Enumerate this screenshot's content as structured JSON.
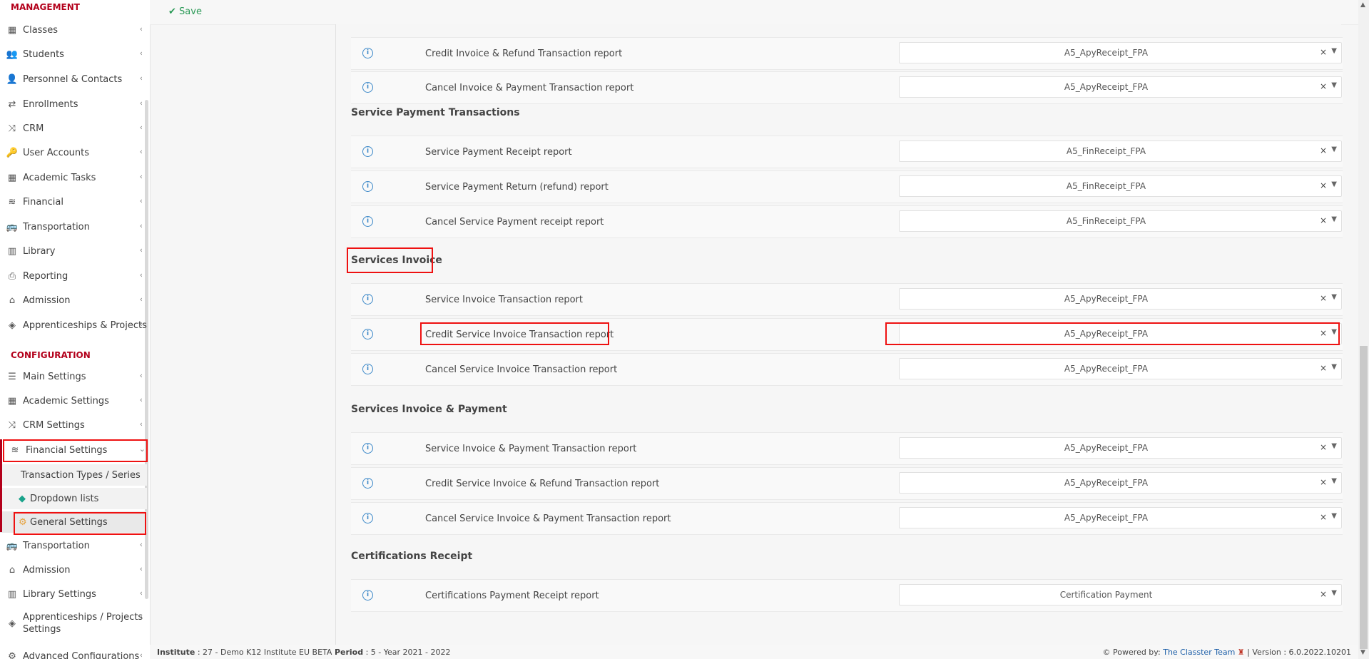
{
  "toolbar": {
    "save_label": "Save"
  },
  "sidebar": {
    "management_label": "MANAGEMENT",
    "configuration_label": "CONFIGURATION",
    "management_items": [
      {
        "label": "Classes",
        "icon": "classes-icon"
      },
      {
        "label": "Students",
        "icon": "students-icon"
      },
      {
        "label": "Personnel & Contacts",
        "icon": "personnel-icon"
      },
      {
        "label": "Enrollments",
        "icon": "enrollments-icon"
      },
      {
        "label": "CRM",
        "icon": "crm-icon"
      },
      {
        "label": "User Accounts",
        "icon": "key-icon"
      },
      {
        "label": "Academic Tasks",
        "icon": "tasks-icon"
      },
      {
        "label": "Financial",
        "icon": "coins-icon"
      },
      {
        "label": "Transportation",
        "icon": "bus-icon"
      },
      {
        "label": "Library",
        "icon": "library-icon"
      },
      {
        "label": "Reporting",
        "icon": "printer-icon"
      },
      {
        "label": "Admission",
        "icon": "institution-icon"
      },
      {
        "label": "Apprenticeships & Projects",
        "icon": "box-icon"
      }
    ],
    "configuration_items": [
      {
        "label": "Main Settings",
        "icon": "sliders-icon"
      },
      {
        "label": "Academic Settings",
        "icon": "classes-icon"
      },
      {
        "label": "CRM Settings",
        "icon": "crm-icon"
      },
      {
        "label": "Financial Settings",
        "icon": "coins-icon"
      }
    ],
    "financial_subitems": [
      {
        "label": "Transaction Types / Series",
        "icon": ""
      },
      {
        "label": "Dropdown lists",
        "icon": "layers-icon"
      },
      {
        "label": "General Settings",
        "icon": "gear-icon"
      }
    ],
    "after_items": [
      {
        "label": "Transportation",
        "icon": "bus-icon"
      },
      {
        "label": "Admission",
        "icon": "institution-icon"
      },
      {
        "label": "Library Settings",
        "icon": "library-icon"
      },
      {
        "label": "Apprenticeships / Projects Settings",
        "icon": "box-icon"
      },
      {
        "label": "Advanced Configurations",
        "icon": "gears-icon"
      }
    ]
  },
  "groups": [
    {
      "title": "",
      "rows": [
        {
          "label": "Credit Invoice & Refund Transaction report",
          "value": "A5_ApyReceipt_FPA"
        },
        {
          "label": "Cancel Invoice & Payment Transaction report",
          "value": "A5_ApyReceipt_FPA"
        }
      ]
    },
    {
      "title": "Service Payment Transactions",
      "rows": [
        {
          "label": "Service Payment Receipt report",
          "value": "A5_FinReceipt_FPA"
        },
        {
          "label": "Service Payment Return (refund) report",
          "value": "A5_FinReceipt_FPA"
        },
        {
          "label": "Cancel Service Payment receipt report",
          "value": "A5_FinReceipt_FPA"
        }
      ]
    },
    {
      "title": "Services Invoice",
      "rows": [
        {
          "label": "Service Invoice Transaction report",
          "value": "A5_ApyReceipt_FPA"
        },
        {
          "label": "Credit Service Invoice Transaction report",
          "value": "A5_ApyReceipt_FPA"
        },
        {
          "label": "Cancel Service Invoice Transaction report",
          "value": "A5_ApyReceipt_FPA"
        }
      ]
    },
    {
      "title": "Services Invoice & Payment",
      "rows": [
        {
          "label": "Service Invoice & Payment Transaction report",
          "value": "A5_ApyReceipt_FPA"
        },
        {
          "label": "Credit Service Invoice & Refund Transaction report",
          "value": "A5_ApyReceipt_FPA"
        },
        {
          "label": "Cancel Service Invoice & Payment Transaction report",
          "value": "A5_ApyReceipt_FPA"
        }
      ]
    },
    {
      "title": "Certifications Receipt",
      "rows": [
        {
          "label": "Certifications Payment Receipt report",
          "value": "Certification Payment"
        }
      ]
    }
  ],
  "footer": {
    "institute_label": "Institute",
    "institute_value": ": 27 - Demo K12 Institute EU BETA",
    "period_label": "Period",
    "period_value": ": 5 - Year 2021 - 2022",
    "powered_by": "Powered by:",
    "team": "The Classter Team",
    "version": "| Version : 6.0.2022.10201"
  }
}
